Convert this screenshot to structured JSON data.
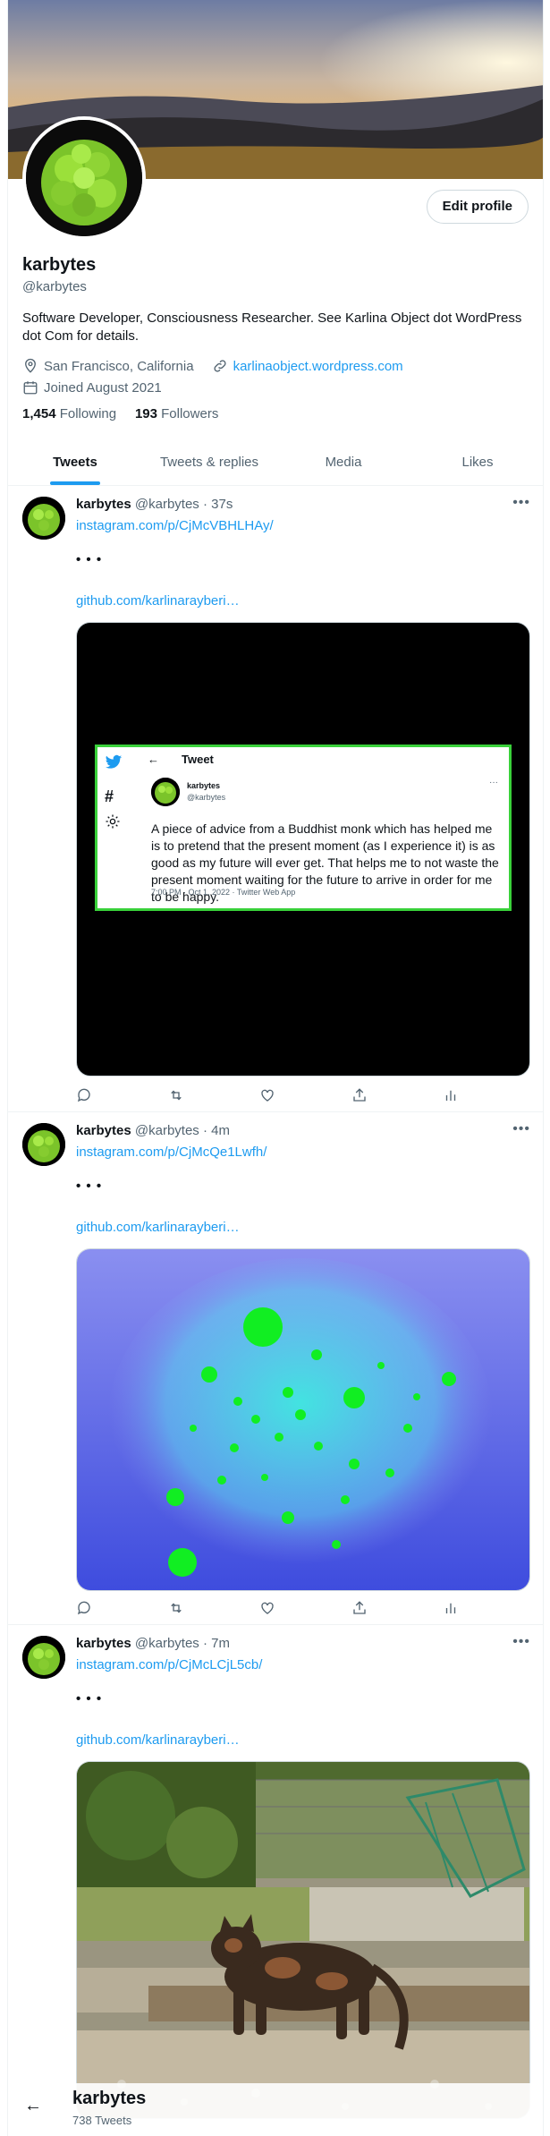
{
  "profile": {
    "name": "karbytes",
    "handle": "@karbytes",
    "edit_label": "Edit profile",
    "bio": "Software Developer, Consciousness Researcher. See Karlina Object dot WordPress dot Com for details.",
    "location": "San Francisco, California",
    "website": "karlinaobject.wordpress.com",
    "joined": "Joined August 2021",
    "following_count": "1,454",
    "following_label": "Following",
    "followers_count": "193",
    "followers_label": "Followers"
  },
  "tabs": [
    "Tweets",
    "Tweets & replies",
    "Media",
    "Likes"
  ],
  "tweets": [
    {
      "name": "karbytes",
      "handle": "@karbytes",
      "time": "· 37s",
      "link1": "instagram.com/p/CjMcVBHLHAy/",
      "dots": "• • •",
      "link2": "github.com/karlinarayberi…"
    },
    {
      "name": "karbytes",
      "handle": "@karbytes",
      "time": "· 4m",
      "link1": "instagram.com/p/CjMcQe1Lwfh/",
      "dots": "• • •",
      "link2": "github.com/karlinarayberi…"
    },
    {
      "name": "karbytes",
      "handle": "@karbytes",
      "time": "· 7m",
      "link1": "instagram.com/p/CjMcLCjL5cb/",
      "dots": "• • •",
      "link2": "github.com/karlinarayberi…"
    }
  ],
  "embedded": {
    "title": "Tweet",
    "arrow": "←",
    "name": "karbytes",
    "handle": "@karbytes",
    "more": "···",
    "text": "A piece of advice from a Buddhist monk which has helped me is to pretend that the present moment (as I experience it) is as good as my future will ever get. That helps me to not waste the present moment waiting for the future to arrive in order for me to be happy.",
    "time": "7:00 PM · Oct 1, 2022 · Twitter Web App"
  },
  "more_glyph": "•••",
  "bottom": {
    "back": "←",
    "name": "karbytes",
    "count": "738 Tweets"
  },
  "colors": {
    "accent": "#1d9bf0",
    "frame_green": "#39d13a"
  }
}
